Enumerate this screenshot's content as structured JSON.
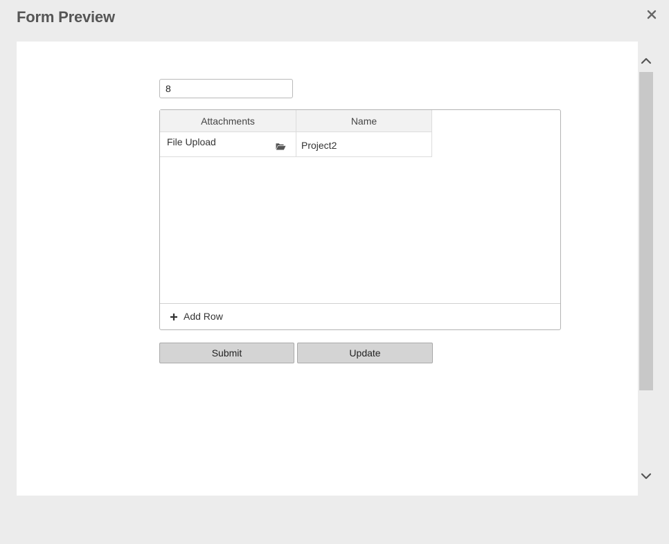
{
  "dialog": {
    "title": "Form Preview",
    "close_icon": "close-icon"
  },
  "form": {
    "number_value": "8",
    "grid": {
      "columns": [
        "Attachments",
        "Name"
      ],
      "rows": [
        {
          "attachment": "File Upload",
          "attachment_icon": "folder-open-icon",
          "name": "Project2"
        }
      ],
      "add_row_label": "Add Row",
      "add_row_icon": "plus-icon"
    },
    "buttons": {
      "submit_label": "Submit",
      "update_label": "Update"
    }
  },
  "scrollbar": {
    "up_icon": "chevron-up-icon",
    "down_icon": "chevron-down-icon"
  }
}
